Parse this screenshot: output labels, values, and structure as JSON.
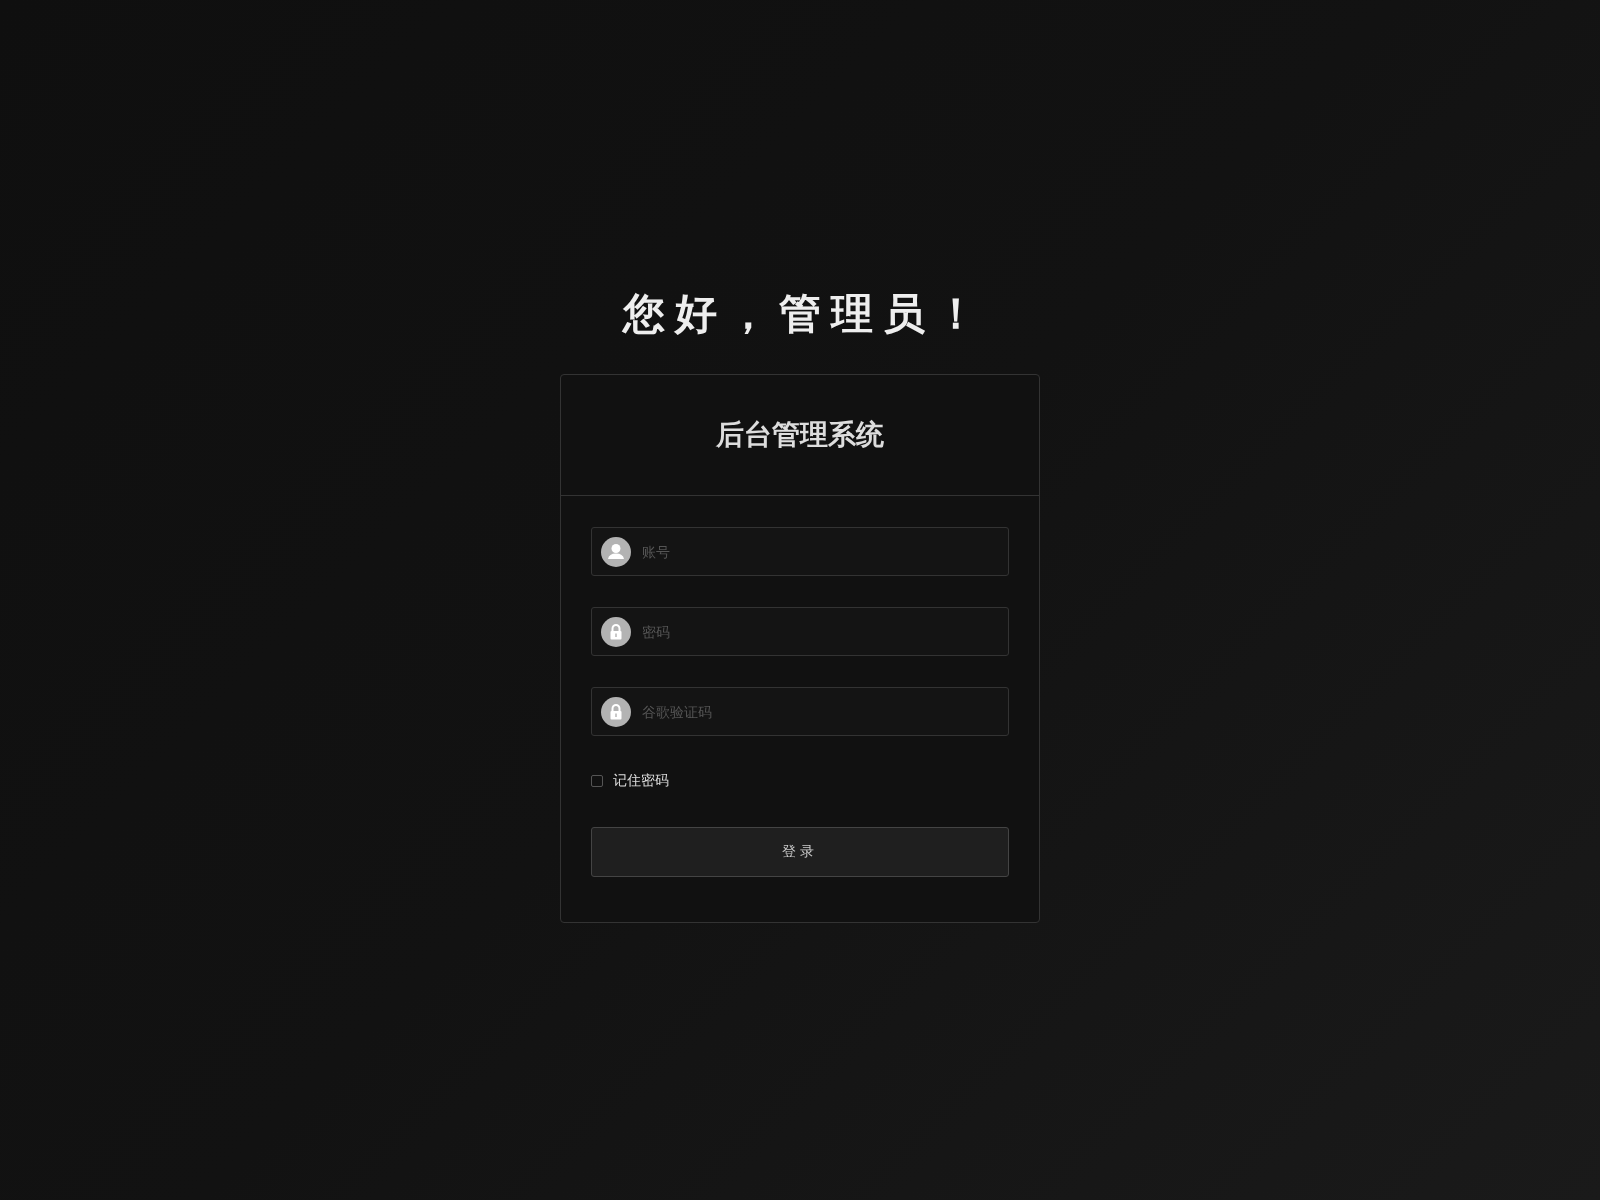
{
  "greeting": "您好，管理员！",
  "card": {
    "title": "后台管理系统",
    "fields": [
      {
        "kind": "user",
        "placeholder": "账号"
      },
      {
        "kind": "lock",
        "placeholder": "密码"
      },
      {
        "kind": "lock",
        "placeholder": "谷歌验证码"
      }
    ],
    "remember": {
      "label": "记住密码",
      "checked": false
    },
    "button": "登录"
  }
}
